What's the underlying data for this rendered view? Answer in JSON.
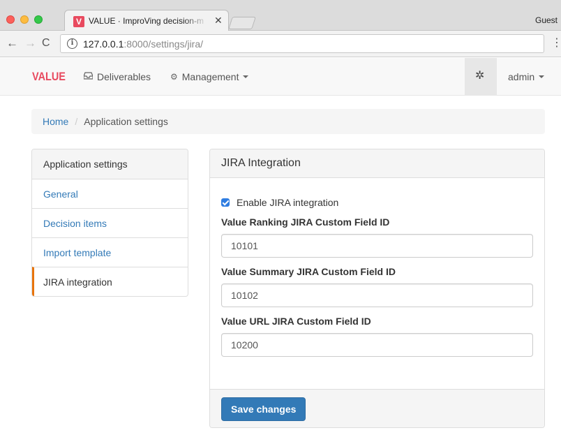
{
  "browser": {
    "tab_title": "VALUE · ImproVing decision-m",
    "tab_favicon_letter": "V",
    "profile_label": "Guest",
    "url_host": "127.0.0.1",
    "url_path": ":8000/settings/jira/"
  },
  "navbar": {
    "brand": "VALUE",
    "deliverables_label": "Deliverables",
    "management_label": "Management",
    "user_label": "admin"
  },
  "breadcrumb": {
    "home": "Home",
    "separator": "/",
    "current": "Application settings"
  },
  "settings_nav": {
    "header": "Application settings",
    "items": [
      {
        "label": "General"
      },
      {
        "label": "Decision items"
      },
      {
        "label": "Import template"
      },
      {
        "label": "JIRA integration"
      }
    ]
  },
  "panel": {
    "title": "JIRA Integration",
    "enable_label": "Enable JIRA integration",
    "enable_checked": true,
    "fields": [
      {
        "label": "Value Ranking JIRA Custom Field ID",
        "value": "10101"
      },
      {
        "label": "Value Summary JIRA Custom Field ID",
        "value": "10102"
      },
      {
        "label": "Value URL JIRA Custom Field ID",
        "value": "10200"
      }
    ],
    "save_label": "Save changes"
  },
  "icons": {
    "deliverables": "inbox-icon",
    "management": "cogs-icon",
    "settings": "gear-icon"
  },
  "colors": {
    "brand": "#e84a5f",
    "link": "#337ab7",
    "primary_button": "#337ab7",
    "active_accent": "#e8740c",
    "checkbox": "#2f7de1"
  }
}
